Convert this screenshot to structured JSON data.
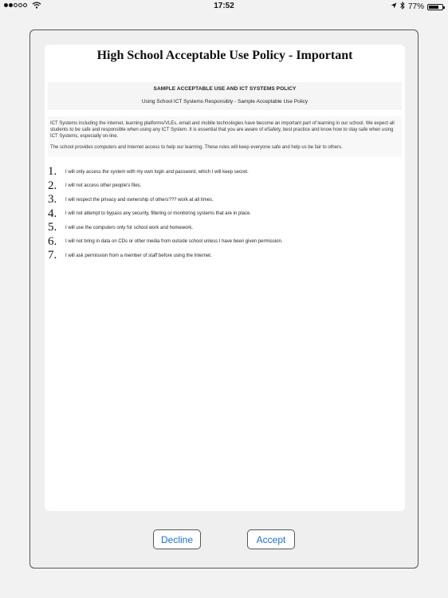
{
  "status_bar": {
    "time": "17:52",
    "battery": "77%",
    "battery_level": 0.77,
    "signal_bars_filled": 2,
    "signal_bars_total": 5
  },
  "document": {
    "title": "High School Acceptable Use Policy - Important",
    "policy_heading": "SAMPLE ACCEPTABLE USE AND ICT SYSTEMS POLICY",
    "policy_subheading": "Using School ICT Systems Responsibly - Sample Acceptable Use Policy",
    "intro_paragraph_1": "ICT Systems including the internet, learning platforms/VLEs, email and mobile technologies have become an important part of learning in our school. We expect all students to be safe and responsible when using any ICT System. It is essential that you are aware of eSafety, best practice and know how to stay safe when using ICT Systems, especially on-line.",
    "intro_paragraph_2": "The school provides computers and Internet access to help our learning. These rules will keep everyone safe and help us be fair to others.",
    "rules": [
      {
        "number": "1.",
        "text": "I will only access the system with my own login and password, which I will keep secret."
      },
      {
        "number": "2.",
        "text": "I will not access other people's files."
      },
      {
        "number": "3.",
        "text": "I will respect the privacy and ownership of others??? work at all times."
      },
      {
        "number": "4.",
        "text": "I will not attempt to bypass any security, filtering or monitoring systems that are in place."
      },
      {
        "number": "5.",
        "text": "I will use the computers only for school work and homework."
      },
      {
        "number": "6.",
        "text": "I will not bring in data on CDs or other media from outside school unless I have been given permission."
      },
      {
        "number": "7.",
        "text": "I will ask permission from a member of staff before using the Internet."
      }
    ]
  },
  "buttons": {
    "decline_label": "Decline",
    "accept_label": "Accept"
  },
  "colors": {
    "button_text": "#1e6fd6",
    "background": "#f2f2f2"
  }
}
